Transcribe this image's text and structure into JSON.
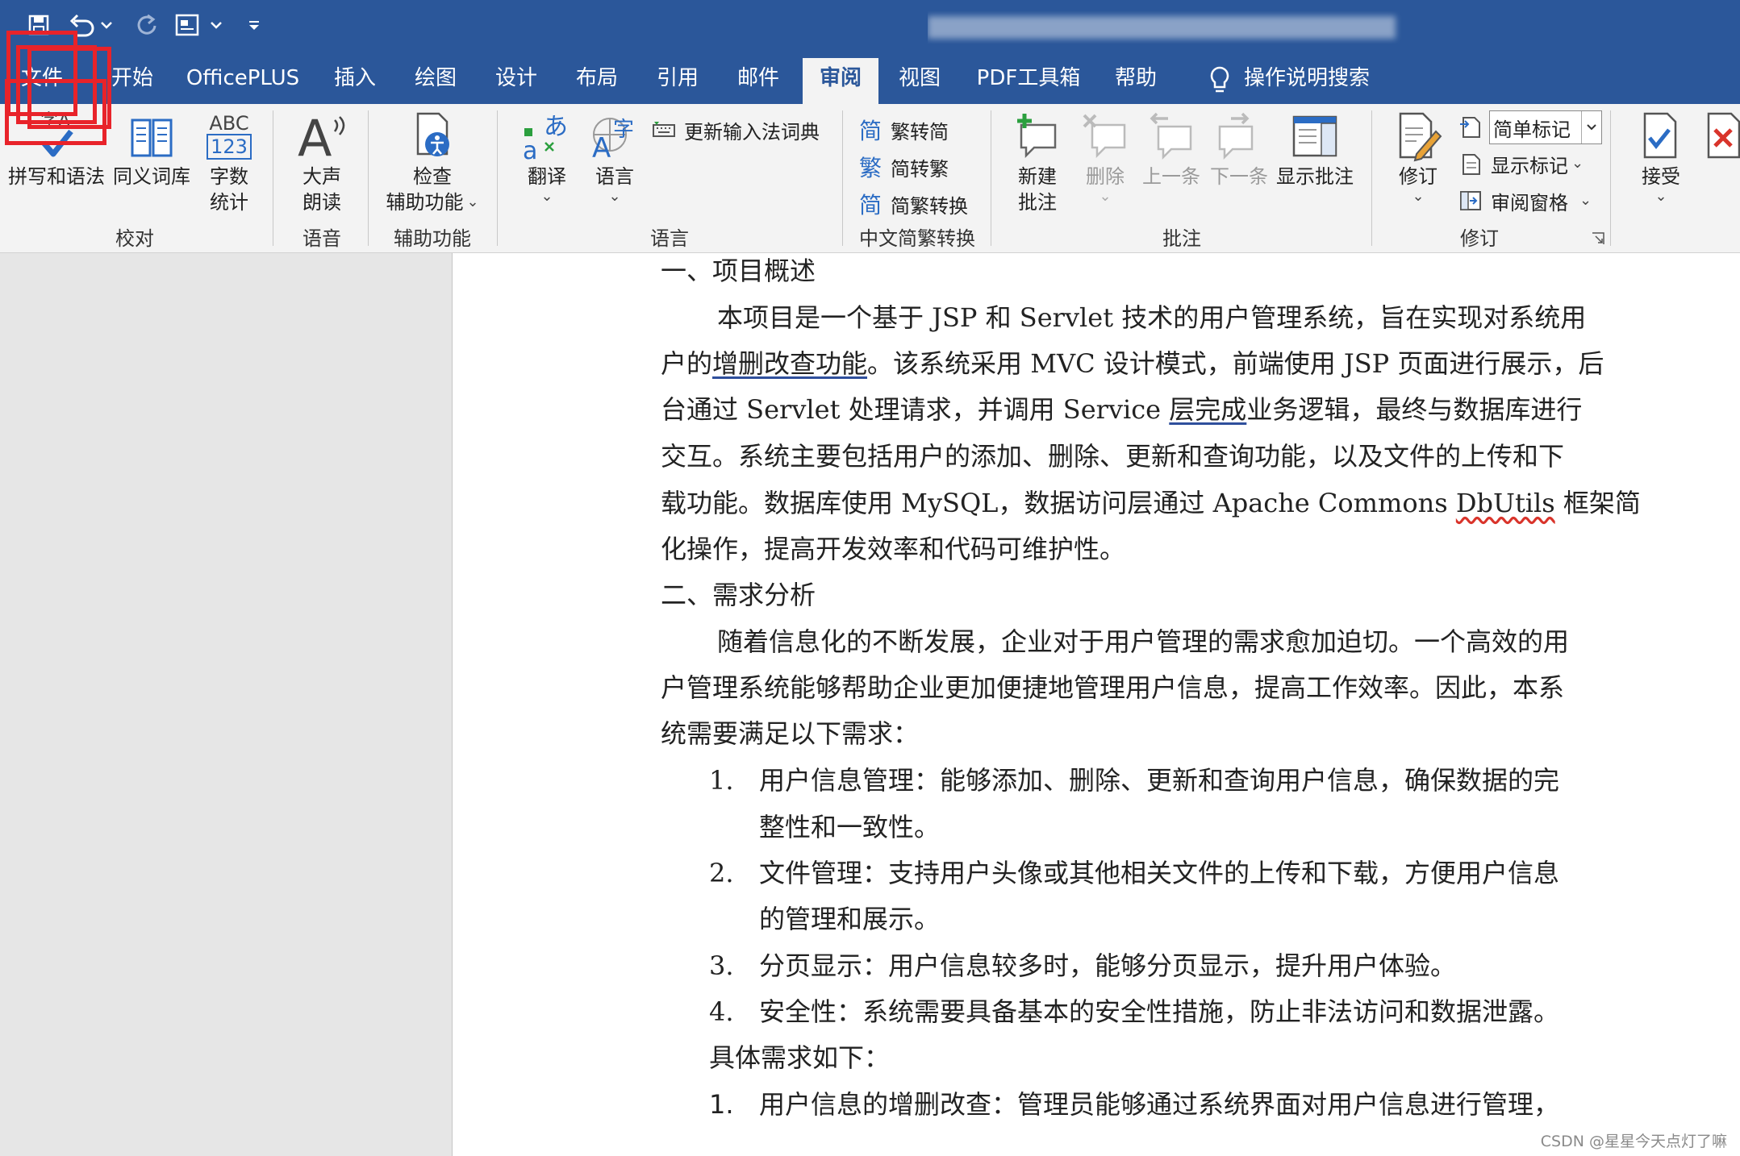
{
  "colors": {
    "titlebar": "#2b579a",
    "ribbon": "#f3f3f3",
    "annotation_red": "#e8232a",
    "revision_underline": "#2f4f9c",
    "spelling_squiggle": "#d9342b"
  },
  "quick_access": {
    "icons": [
      "save-icon",
      "undo-icon",
      "redo-icon",
      "read-mode-icon",
      "customize-icon"
    ]
  },
  "tabs": [
    "文件",
    "开始",
    "OfficePLUS",
    "插入",
    "绘图",
    "设计",
    "布局",
    "引用",
    "邮件",
    "审阅",
    "视图",
    "PDF工具箱",
    "帮助"
  ],
  "tell_me": "操作说明搜索",
  "active_tab": "审阅",
  "ribbon": {
    "proofing": {
      "spelling": "拼写和语法",
      "thesaurus": "同义词库",
      "wordcount_line1": "字数",
      "wordcount_line2": "统计",
      "wordcount_icon_text_1": "ABC",
      "wordcount_icon_text_2": "123",
      "group": "校对"
    },
    "speech": {
      "readaloud_line1": "大声",
      "readaloud_line2": "朗读",
      "group": "语音"
    },
    "accessibility": {
      "check_line1": "检查",
      "check_line2": "辅助功能",
      "group": "辅助功能"
    },
    "language": {
      "translate": "翻译",
      "language": "语言",
      "update_ime": "更新输入法词典",
      "group": "语言"
    },
    "chinese": {
      "t2s": "繁转简",
      "s2t": "简转繁",
      "convert": "简繁转换",
      "group": "中文简繁转换"
    },
    "comments": {
      "new_line1": "新建",
      "new_line2": "批注",
      "delete": "删除",
      "previous": "上一条",
      "next": "下一条",
      "show": "显示批注",
      "group": "批注"
    },
    "tracking": {
      "track": "修订",
      "markup_select": "简单标记",
      "show_markup": "显示标记",
      "reviewing_pane": "审阅窗格",
      "group": "修订"
    },
    "changes": {
      "accept": "接受"
    }
  },
  "document": {
    "lines": [
      "一、项目概述",
      "本项目是一个基于 JSP 和 Servlet 技术的用户管理系统，旨在实现对系统用",
      [
        "户的",
        "增删改查功能",
        "。该系统采用 MVC 设计模式，前端使用 JSP 页面进行展示，后"
      ],
      [
        "台通过 Servlet 处理请求，并调用 Service ",
        "层完成",
        "业务逻辑，最终与数据库进行"
      ],
      "交互。系统主要包括用户的添加、删除、更新和查询功能，以及文件的上传和下",
      [
        "载功能。数据库使用 MySQL，数据访问层通过 Apache Commons ",
        "DbUtils",
        " 框架简"
      ],
      "化操作，提高开发效率和代码可维护性。",
      "二、需求分析",
      "随着信息化的不断发展，企业对于用户管理的需求愈加迫切。一个高效的用",
      "户管理系统能够帮助企业更加便捷地管理用户信息，提高工作效率。因此，本系",
      "统需要满足以下需求：",
      "用户信息管理：能够添加、删除、更新和查询用户信息，确保数据的完",
      "整性和一致性。",
      "文件管理：支持用户头像或其他相关文件的上传和下载，方便用户信息",
      "的管理和展示。",
      "分页显示：用户信息较多时，能够分页显示，提升用户体验。",
      "安全性：系统需要具备基本的安全性措施，防止非法访问和数据泄露。",
      "具体需求如下：",
      "用户信息的增删改查：管理员能够通过系统界面对用户信息进行管理，"
    ],
    "list_numbers": [
      "1.",
      "2.",
      "3.",
      "4.",
      "1."
    ]
  },
  "watermark": "CSDN @星星今天点灯了嘛"
}
